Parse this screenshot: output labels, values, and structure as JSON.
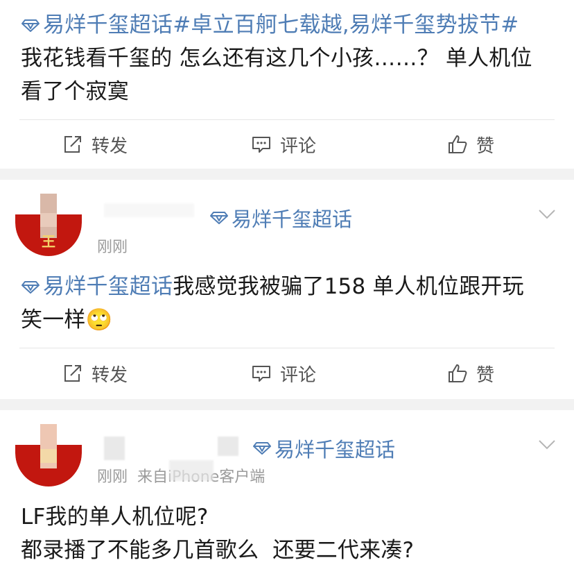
{
  "post1": {
    "topic_tag": "易烊千玺超话#卓立百舸七载越,易烊千玺势拔节#",
    "text_line1": "我花钱看千玺的 怎么还有这几个小孩……？ 单人机位",
    "text_line2": "看了个寂寞"
  },
  "actions": {
    "repost": "转发",
    "comment": "评论",
    "like": "赞"
  },
  "post2": {
    "supertopic": "易烊千玺超话",
    "time": "刚刚",
    "topic_tag": "易烊千玺超话",
    "text_line1": "我感觉我被骗了158 单人机位跟开玩",
    "text_line2": "笑一样🙄"
  },
  "post3": {
    "supertopic": "易烊千玺超话",
    "time_source": "刚刚  来自iPhone客户端",
    "text_line1": "LF我的单人机位呢?",
    "text_line2": "都录播了不能多几首歌么  还要二代来凑?"
  },
  "colors": {
    "link": "#4f7db5",
    "separator": "#f2f2f2",
    "avatar_red": "#c2170f"
  },
  "icons": {
    "repost": "repost-icon",
    "comment": "comment-icon",
    "like": "thumbs-up-icon",
    "supertopic": "diamond-icon",
    "menu": "chevron-down-icon"
  }
}
